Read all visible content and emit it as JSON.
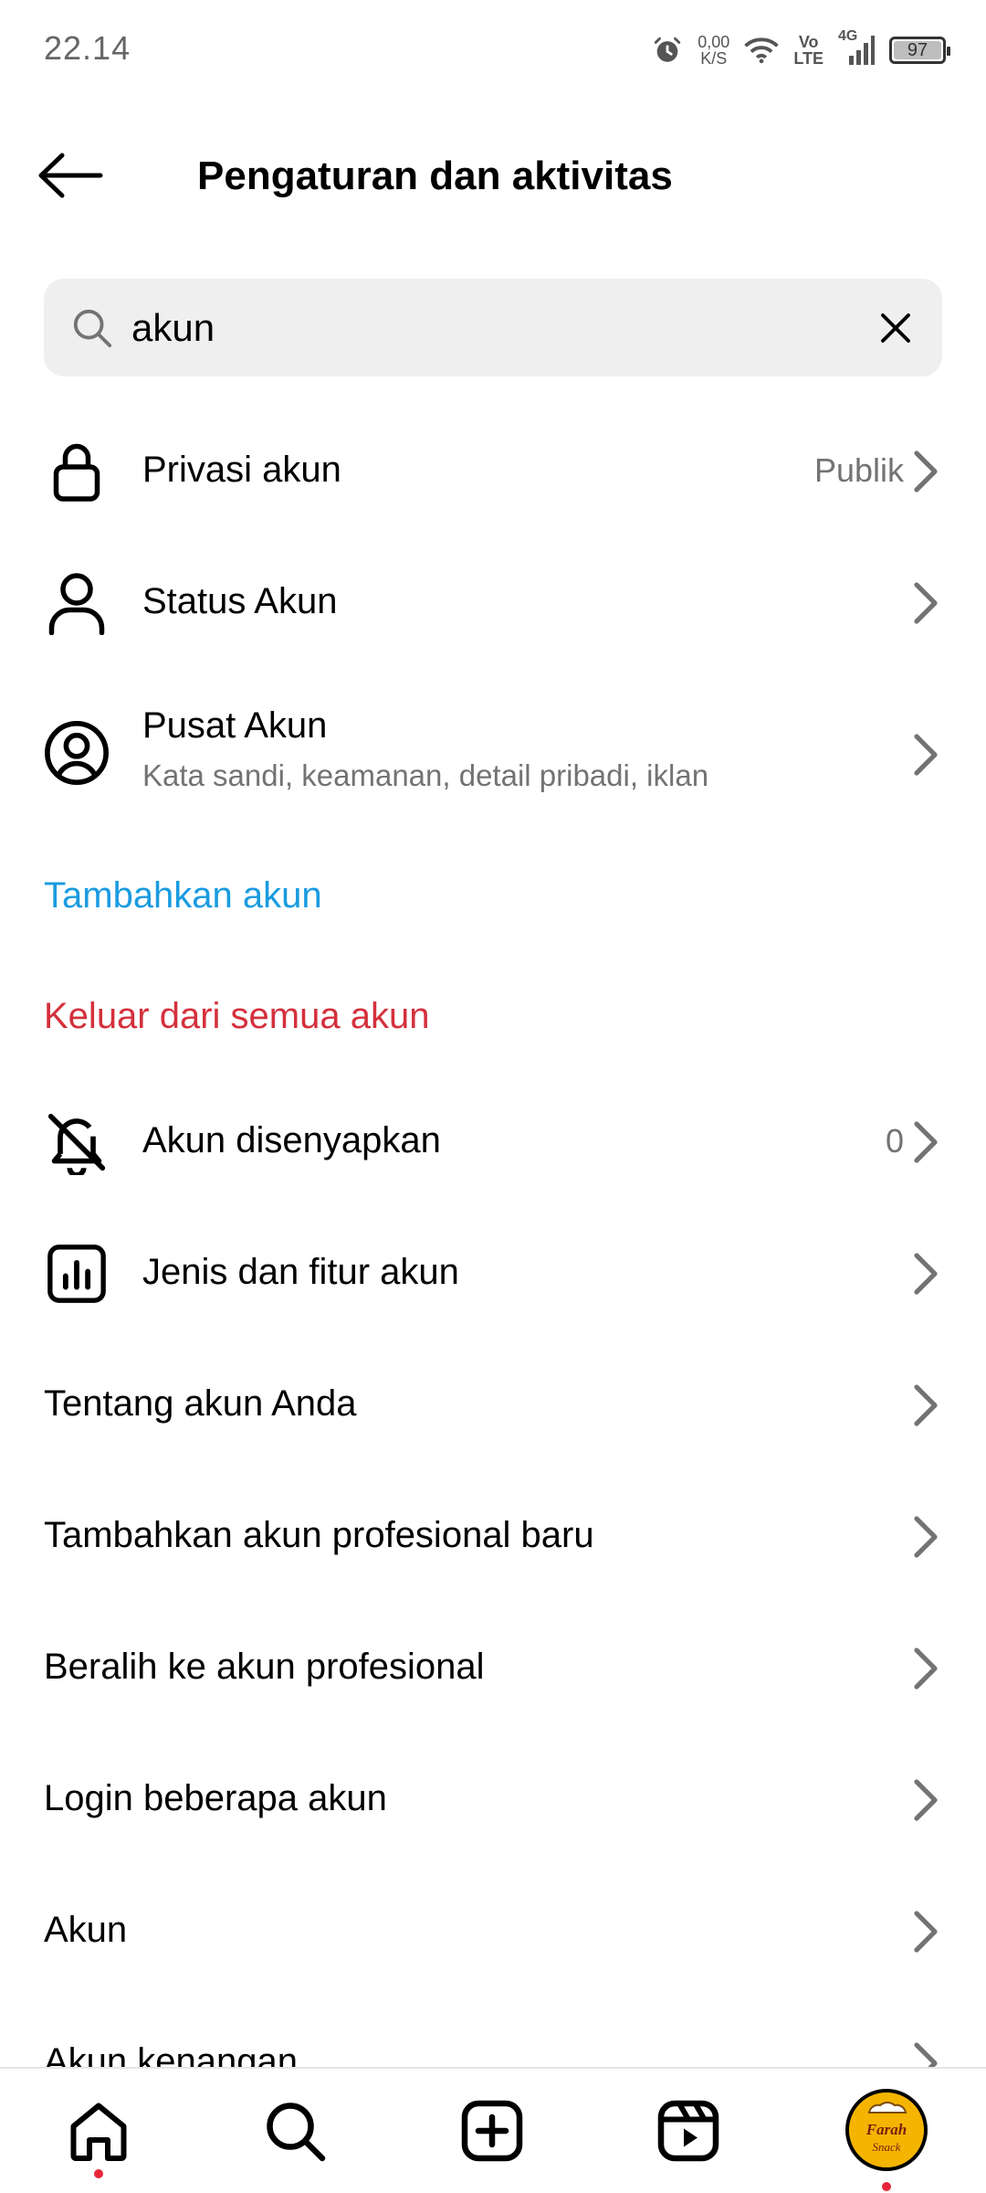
{
  "status_bar": {
    "time": "22.14",
    "netspeed_value": "0,00",
    "netspeed_unit": "K/S",
    "volte_top": "Vo",
    "volte_bottom": "LTE",
    "network": "4G",
    "battery": "97"
  },
  "header": {
    "title": "Pengaturan dan aktivitas",
    "back_icon": "arrow-left-icon"
  },
  "search": {
    "value": "akun",
    "icon": "search-icon",
    "clear_icon": "close-icon"
  },
  "items": {
    "privasi": {
      "label": "Privasi akun",
      "value": "Publik",
      "icon": "lock-icon"
    },
    "status": {
      "label": "Status Akun",
      "icon": "person-icon"
    },
    "pusat": {
      "label": "Pusat Akun",
      "sub": "Kata sandi, keamanan, detail pribadi, iklan",
      "icon": "account-circle-icon"
    },
    "tambahkan": {
      "label": "Tambahkan akun",
      "color": "#1a9be0"
    },
    "keluar": {
      "label": "Keluar dari semua akun",
      "color": "#d4303c"
    },
    "disenyapkan": {
      "label": "Akun disenyapkan",
      "value": "0",
      "icon": "bell-off-icon"
    },
    "jenis": {
      "label": "Jenis dan fitur akun",
      "icon": "bar-chart-icon"
    },
    "tentang": {
      "label": "Tentang akun Anda"
    },
    "profesional_baru": {
      "label": "Tambahkan akun profesional baru"
    },
    "beralih": {
      "label": "Beralih ke akun profesional"
    },
    "login": {
      "label": "Login beberapa akun"
    },
    "akun": {
      "label": "Akun"
    },
    "kenangan": {
      "label": "Akun kenangan"
    }
  },
  "bottom_nav": {
    "items": [
      "home-icon",
      "search-icon",
      "create-icon",
      "reels-icon",
      "profile-avatar"
    ],
    "avatar_text_top": "Farah",
    "avatar_text_bottom": "Snack"
  }
}
